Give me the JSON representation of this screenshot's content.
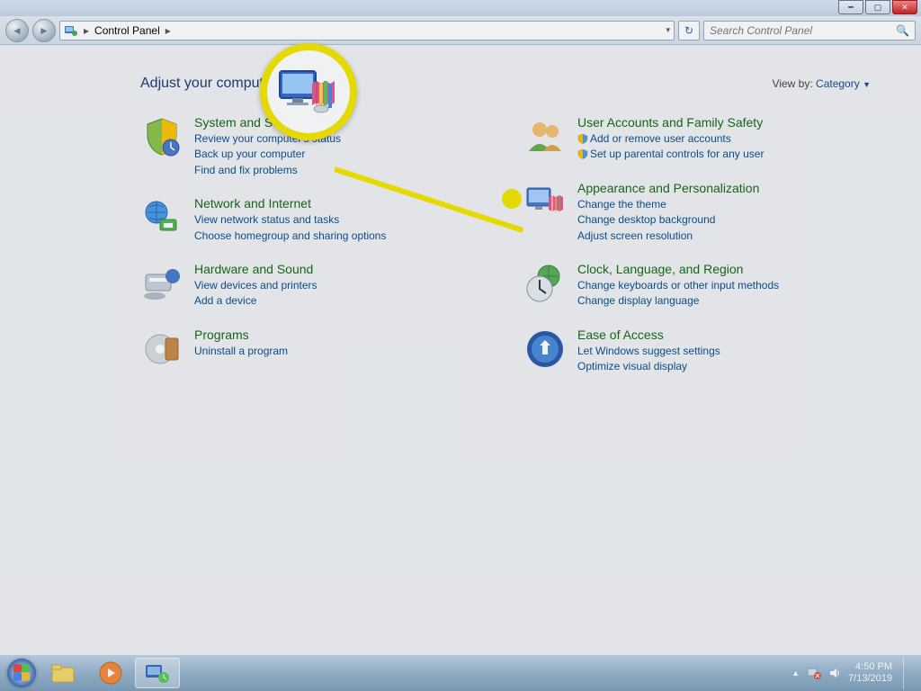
{
  "window": {
    "breadcrumb_root": "Control Panel",
    "search_placeholder": "Search Control Panel"
  },
  "heading": "Adjust your computer's settings",
  "viewby": {
    "label": "View by:",
    "value": "Category"
  },
  "categories": {
    "system": {
      "title": "System and Security",
      "links": [
        "Review your computer's status",
        "Back up your computer",
        "Find and fix problems"
      ]
    },
    "network": {
      "title": "Network and Internet",
      "links": [
        "View network status and tasks",
        "Choose homegroup and sharing options"
      ]
    },
    "hardware": {
      "title": "Hardware and Sound",
      "links": [
        "View devices and printers",
        "Add a device"
      ]
    },
    "programs": {
      "title": "Programs",
      "links": [
        "Uninstall a program"
      ]
    },
    "users": {
      "title": "User Accounts and Family Safety",
      "links": [
        "Add or remove user accounts",
        "Set up parental controls for any user"
      ]
    },
    "appearance": {
      "title": "Appearance and Personalization",
      "links": [
        "Change the theme",
        "Change desktop background",
        "Adjust screen resolution"
      ]
    },
    "clock": {
      "title": "Clock, Language, and Region",
      "links": [
        "Change keyboards or other input methods",
        "Change display language"
      ]
    },
    "ease": {
      "title": "Ease of Access",
      "links": [
        "Let Windows suggest settings",
        "Optimize visual display"
      ]
    }
  },
  "taskbar": {
    "time": "4:50 PM",
    "date": "7/13/2019"
  },
  "callout_target": "appearance"
}
